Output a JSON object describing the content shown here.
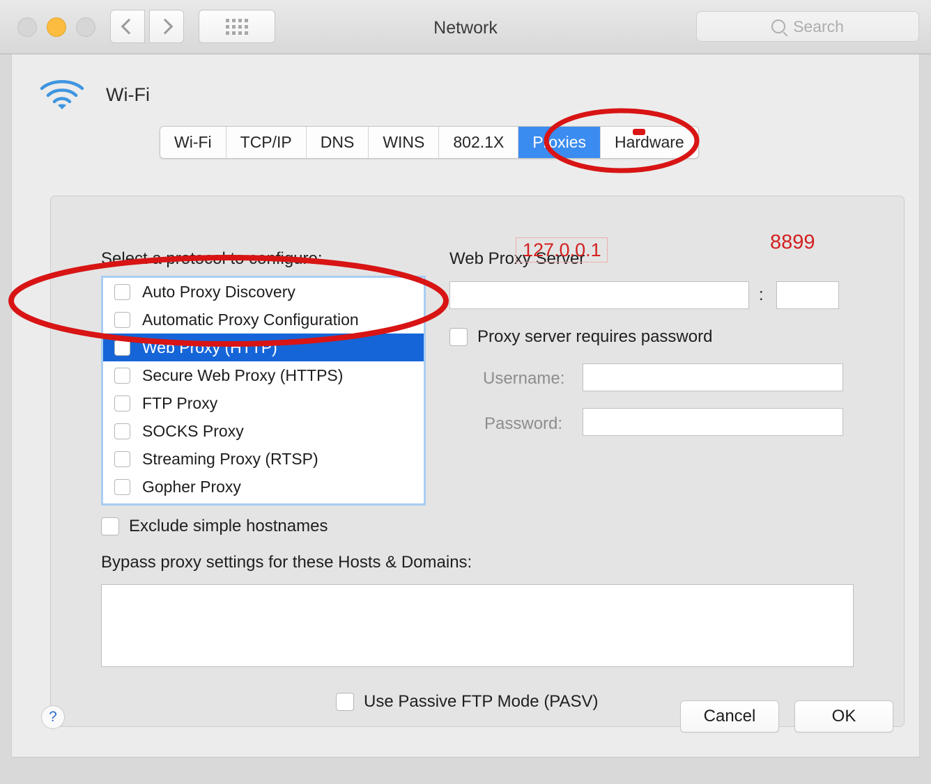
{
  "window": {
    "title": "Network",
    "traffic_lights": [
      "close",
      "minimize",
      "zoom"
    ],
    "nav": {
      "back": "back-arrow",
      "forward": "forward-arrow",
      "grid": "grid-view-button"
    },
    "search": {
      "placeholder": "Search",
      "value": ""
    }
  },
  "interface": {
    "icon": "wifi-icon",
    "name": "Wi-Fi"
  },
  "tabs": [
    {
      "label": "Wi-Fi",
      "active": false
    },
    {
      "label": "TCP/IP",
      "active": false
    },
    {
      "label": "DNS",
      "active": false
    },
    {
      "label": "WINS",
      "active": false
    },
    {
      "label": "802.1X",
      "active": false
    },
    {
      "label": "Proxies",
      "active": true
    },
    {
      "label": "Hardware",
      "active": false
    }
  ],
  "proxies": {
    "protocol_label": "Select a protocol to configure:",
    "protocols": [
      {
        "label": "Auto Proxy Discovery",
        "checked": false,
        "selected": false
      },
      {
        "label": "Automatic Proxy Configuration",
        "checked": false,
        "selected": false
      },
      {
        "label": "Web Proxy (HTTP)",
        "checked": false,
        "selected": true
      },
      {
        "label": "Secure Web Proxy (HTTPS)",
        "checked": false,
        "selected": false
      },
      {
        "label": "FTP Proxy",
        "checked": false,
        "selected": false
      },
      {
        "label": "SOCKS Proxy",
        "checked": false,
        "selected": false
      },
      {
        "label": "Streaming Proxy (RTSP)",
        "checked": false,
        "selected": false
      },
      {
        "label": "Gopher Proxy",
        "checked": false,
        "selected": false
      }
    ],
    "exclude_simple_hostnames": {
      "label": "Exclude simple hostnames",
      "checked": false
    },
    "bypass_label": "Bypass proxy settings for these Hosts & Domains:",
    "bypass_value": "",
    "passive_ftp": {
      "label": "Use Passive FTP Mode (PASV)",
      "checked": false
    }
  },
  "server": {
    "title": "Web Proxy Server",
    "host_value": "",
    "port_separator": ":",
    "port_value": "",
    "requires_password": {
      "label": "Proxy server requires password",
      "checked": false
    },
    "username_label": "Username:",
    "username_value": "",
    "password_label": "Password:",
    "password_value": ""
  },
  "footer": {
    "help": "?",
    "cancel": "Cancel",
    "ok": "OK"
  },
  "annotations": {
    "color": "#d81414",
    "host_text": "127.0.0.1",
    "port_text": "8899",
    "ellipse_tab": "Proxies",
    "ellipse_protocol": "Web Proxy (HTTP)"
  }
}
